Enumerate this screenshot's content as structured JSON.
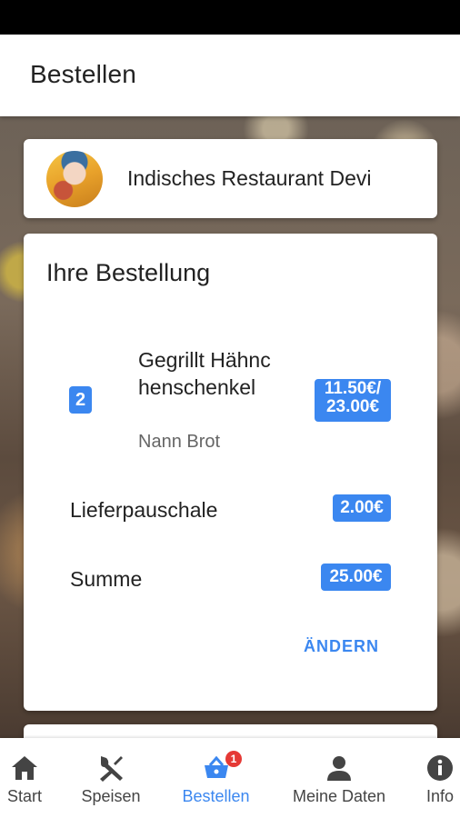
{
  "app_bar": {
    "title": "Bestellen"
  },
  "restaurant": {
    "name": "Indisches Restaurant Devi"
  },
  "order": {
    "title": "Ihre Bestellung",
    "items": [
      {
        "quantity": "2",
        "name": "Gegrillt Hähnchenschenkel",
        "extra": "Nann Brot",
        "price_unit": "11.50€/",
        "price_total": "23.00€"
      }
    ],
    "delivery_label": "Lieferpauschale",
    "delivery_price": "2.00€",
    "sum_label": "Summe",
    "sum_price": "25.00€",
    "change_label": "ÄNDERN"
  },
  "bottom_nav": {
    "items": [
      {
        "label": "Start",
        "icon": "home-icon"
      },
      {
        "label": "Speisen",
        "icon": "utensils-icon"
      },
      {
        "label": "Bestellen",
        "icon": "basket-icon",
        "badge": "1"
      },
      {
        "label": "Meine Daten",
        "icon": "person-icon"
      },
      {
        "label": "Info",
        "icon": "info-icon"
      }
    ]
  },
  "colors": {
    "accent": "#3b87f0",
    "badge": "#e53935"
  }
}
